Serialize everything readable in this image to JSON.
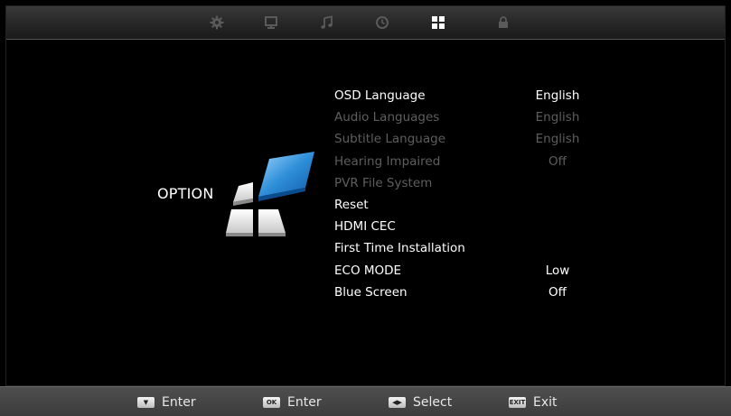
{
  "screen_title": "OPTION",
  "top_tabs": [
    {
      "icon": "gear-icon",
      "active": false
    },
    {
      "icon": "monitor-icon",
      "active": false
    },
    {
      "icon": "music-note-icon",
      "active": false
    },
    {
      "icon": "clock-icon",
      "active": false
    },
    {
      "icon": "option-grid-icon",
      "active": true
    },
    {
      "icon": "lock-icon",
      "active": false
    }
  ],
  "menu": [
    {
      "label": "OSD Language",
      "value": "English",
      "enabled": true
    },
    {
      "label": "Audio Languages",
      "value": "English",
      "enabled": false
    },
    {
      "label": "Subtitle Language",
      "value": "English",
      "enabled": false
    },
    {
      "label": "Hearing Impaired",
      "value": "Off",
      "enabled": false
    },
    {
      "label": "PVR File System",
      "value": "",
      "enabled": false
    },
    {
      "label": "Reset",
      "value": "",
      "enabled": true
    },
    {
      "label": "HDMI CEC",
      "value": "",
      "enabled": true
    },
    {
      "label": "First Time Installation",
      "value": "",
      "enabled": true
    },
    {
      "label": "ECO MODE",
      "value": "Low",
      "enabled": true
    },
    {
      "label": "Blue Screen",
      "value": "Off",
      "enabled": true
    }
  ],
  "footer": [
    {
      "key": "down-arrow-key-icon",
      "key_text": "▼",
      "label": "Enter"
    },
    {
      "key": "ok-key-icon",
      "key_text": "OK",
      "label": "Enter"
    },
    {
      "key": "left-right-key-icon",
      "key_text": "◀▶",
      "label": "Select"
    },
    {
      "key": "exit-key-icon",
      "key_text": "EXIT",
      "label": "Exit"
    }
  ],
  "colors": {
    "accent_blue": "#2f8fd8",
    "active_text": "#ffffff",
    "disabled_text": "#5e5e5e"
  }
}
